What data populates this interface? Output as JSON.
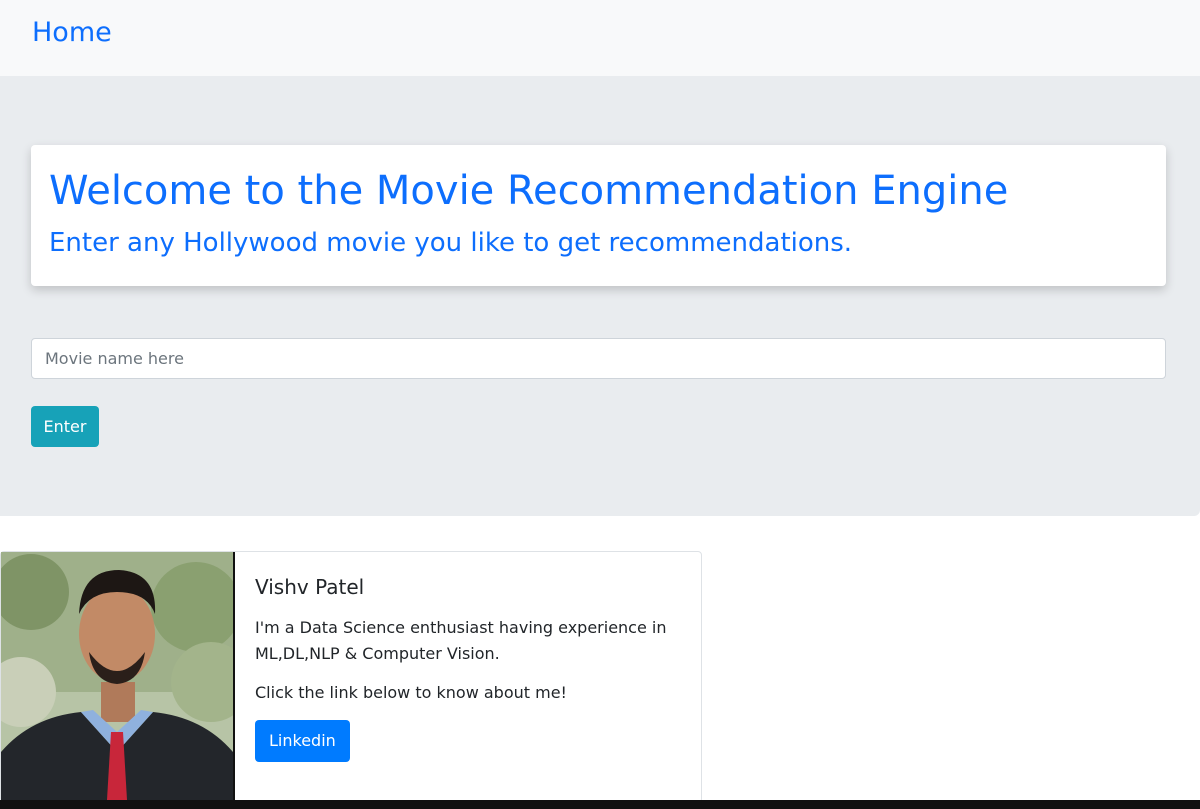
{
  "navbar": {
    "home_label": "Home"
  },
  "hero": {
    "title": "Welcome to the Movie Recommendation Engine",
    "subtitle": "Enter any Hollywood movie you like to get recommendations."
  },
  "search": {
    "placeholder": "Movie name here",
    "value": "",
    "submit_label": "Enter"
  },
  "profile": {
    "name": "Vishv Patel",
    "description": "I'm a Data Science enthusiast having experience in ML,DL,NLP & Computer Vision.",
    "cta": "Click the link below to know about me!",
    "link_label": "Linkedin"
  },
  "colors": {
    "primary": "#0d6efd",
    "info_button": "#17a2b8",
    "link_button": "#007bff",
    "jumbotron_bg": "#e9ecef"
  }
}
